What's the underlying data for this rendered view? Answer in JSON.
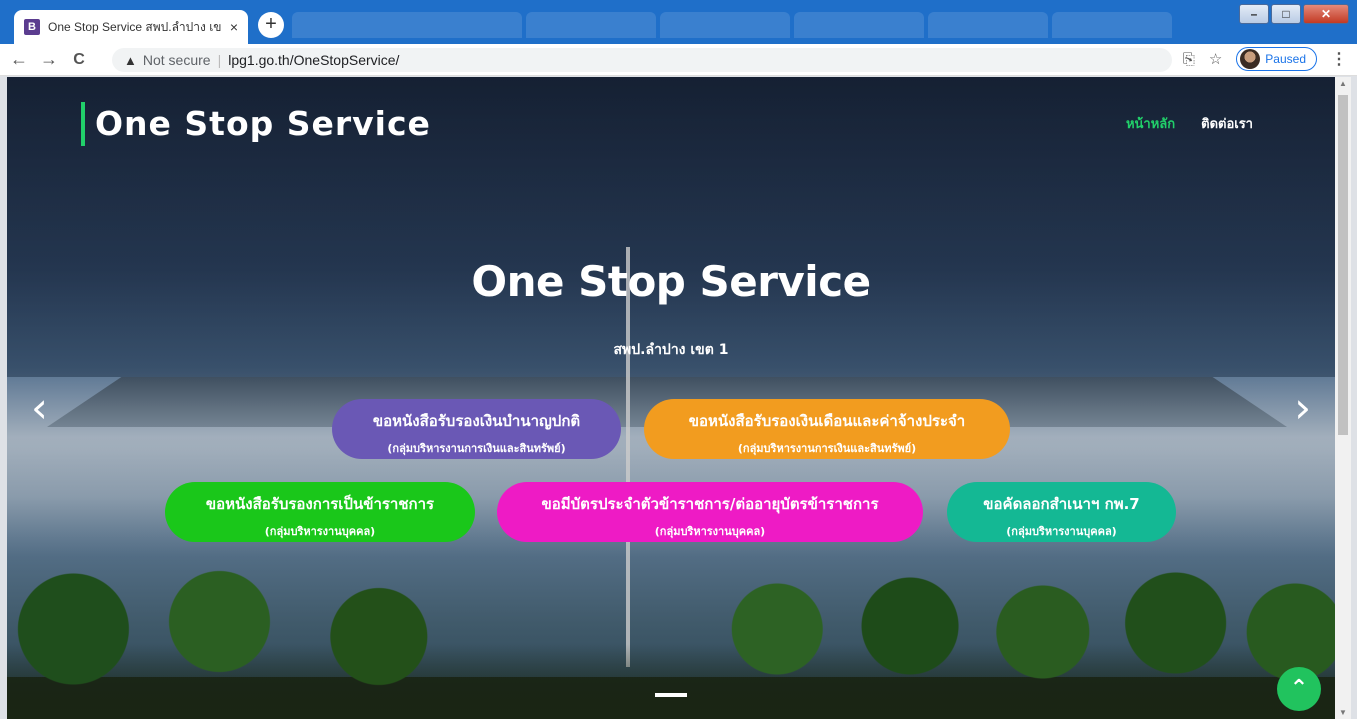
{
  "browser": {
    "tab_favicon": "B",
    "tab_title": "One Stop Service สพป.ลำปาง เขต 1",
    "tab_close": "×",
    "new_tab": "+",
    "window_controls": {
      "minimize": "–",
      "maximize": "□",
      "close": "✕"
    },
    "back": "←",
    "forward": "→",
    "reload": "C",
    "security_icon": "▲",
    "security_label": "Not secure",
    "url": "lpg1.go.th/OneStopService/",
    "translate_icon": "⎘",
    "star_icon": "☆",
    "profile_status": "Paused",
    "menu_icon": "⋮"
  },
  "site": {
    "brand": "One Stop Service",
    "nav": [
      {
        "label": "หน้าหลัก",
        "active": true
      },
      {
        "label": "ติดต่อเรา",
        "active": false
      }
    ]
  },
  "hero": {
    "title": "One Stop Service",
    "subtitle": "สพป.ลำปาง เขต 1",
    "prev_arrow": "‹",
    "next_arrow": "›"
  },
  "services": [
    {
      "title": "ขอหนังสือรับรองเงินบำนาญปกติ",
      "subtitle": "(กลุ่มบริหารงานการเงินและสินทรัพย์)",
      "color": "#6a58b5"
    },
    {
      "title": "ขอหนังสือรับรองเงินเดือนและค่าจ้างประจำ",
      "subtitle": "(กลุ่มบริหารงานการเงินและสินทรัพย์)",
      "color": "#f29c1f"
    },
    {
      "title": "ขอหนังสือรับรองการเป็นข้าราชการ",
      "subtitle": "(กลุ่มบริหารงานบุคคล)",
      "color": "#1ac71a"
    },
    {
      "title": "ขอมีบัตรประจำตัวข้าราชการ/ต่ออายุบัตรข้าราชการ",
      "subtitle": "(กลุ่มบริหารงานบุคคล)",
      "color": "#ee1bc5"
    },
    {
      "title": "ขอคัดลอกสำเนาฯ กพ.7",
      "subtitle": "(กลุ่มบริหารงานบุคคล)",
      "color": "#14b894"
    }
  ],
  "back_to_top": "⌃"
}
